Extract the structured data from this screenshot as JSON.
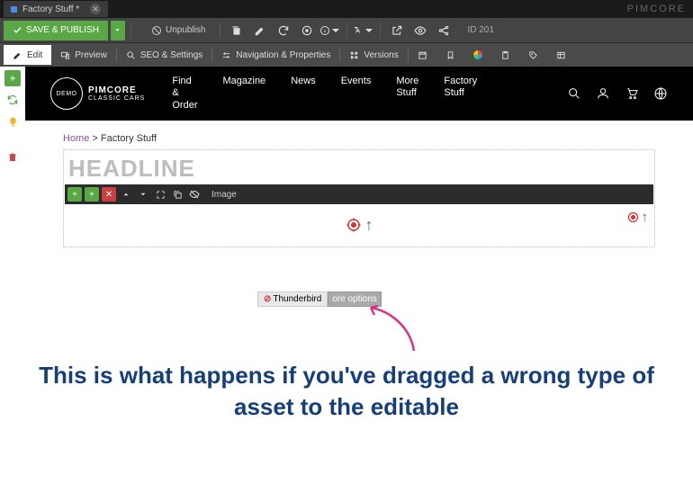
{
  "brand": "PIMCORE",
  "tab": {
    "title": "Factory Stuff *"
  },
  "toolbar": {
    "save_publish": "SAVE & PUBLISH",
    "unpublish": "Unpublish",
    "id": "ID 201"
  },
  "modes": {
    "edit": "Edit",
    "preview": "Preview",
    "seo": "SEO & Settings",
    "nav": "Navigation & Properties",
    "versions": "Versions"
  },
  "sitenav": {
    "find": "Find\n&\nOrder",
    "magazine": "Magazine",
    "news": "News",
    "events": "Events",
    "more": "More\nStuff",
    "factory": "Factory\nStuff"
  },
  "logo": {
    "line1": "PIMCORE",
    "line2": "CLASSIC CARS",
    "badge": "DEMO"
  },
  "breadcrumb": {
    "home": "Home",
    "current": "Factory Stuff"
  },
  "editor": {
    "headline_placeholder": "HEADLINE",
    "block_label": "Image"
  },
  "drag": {
    "item_name": "Thunderbird",
    "trailing": "ore options"
  },
  "caption": "This is what happens if you've dragged a wrong type of asset to the editable"
}
